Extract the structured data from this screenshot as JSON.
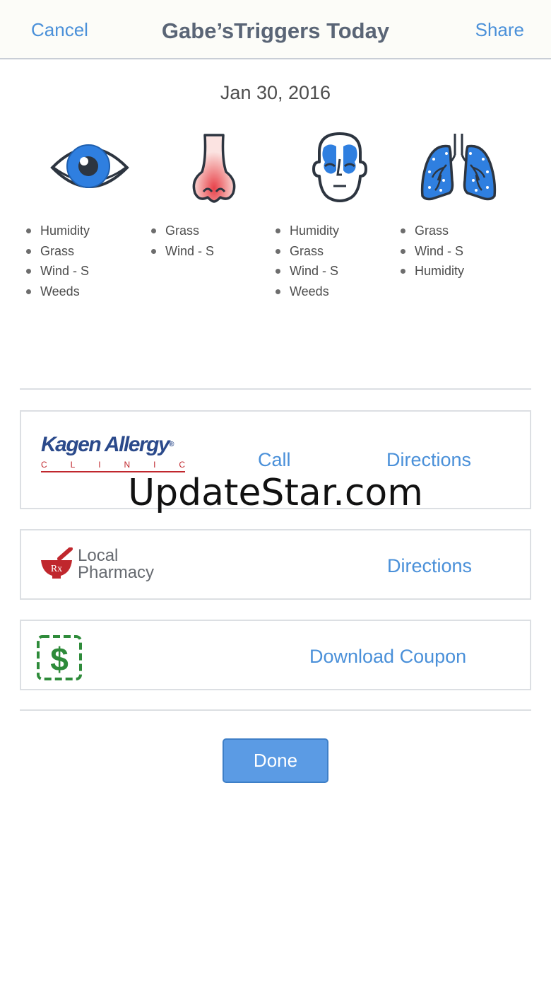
{
  "header": {
    "cancel_label": "Cancel",
    "title": "Gabe’sTriggers Today",
    "share_label": "Share"
  },
  "date": "Jan 30, 2016",
  "trigger_groups": [
    {
      "icon": "eye-icon",
      "items": [
        "Humidity",
        "Grass",
        "Wind - S",
        "Weeds"
      ]
    },
    {
      "icon": "nose-icon",
      "items": [
        "Grass",
        "Wind - S"
      ]
    },
    {
      "icon": "sinus-face-icon",
      "items": [
        "Humidity",
        "Grass",
        "Wind - S",
        "Weeds"
      ]
    },
    {
      "icon": "lungs-icon",
      "items": [
        "Grass",
        "Wind - S",
        "Humidity"
      ]
    }
  ],
  "clinic": {
    "logo_name": "Kagen Allergy",
    "logo_reg": "®",
    "logo_sub": [
      "C",
      "L",
      "I",
      "N",
      "I",
      "C"
    ],
    "call_label": "Call",
    "directions_label": "Directions"
  },
  "pharmacy": {
    "logo_line1": "Local",
    "logo_line2": "Pharmacy",
    "rx_mark": "Rx",
    "directions_label": "Directions"
  },
  "coupon": {
    "icon": "dollar-coupon-icon",
    "symbol": "$",
    "download_label": "Download Coupon"
  },
  "done_label": "Done",
  "watermark": "UpdateStar.com",
  "colors": {
    "accent": "#4a90d9",
    "button": "#5b9be4",
    "icon_blue": "#2f7fe0",
    "clinic_navy": "#2b4a8b",
    "clinic_red": "#c0272d",
    "rx_red": "#c0272d",
    "coupon_green": "#2e8b3a"
  }
}
